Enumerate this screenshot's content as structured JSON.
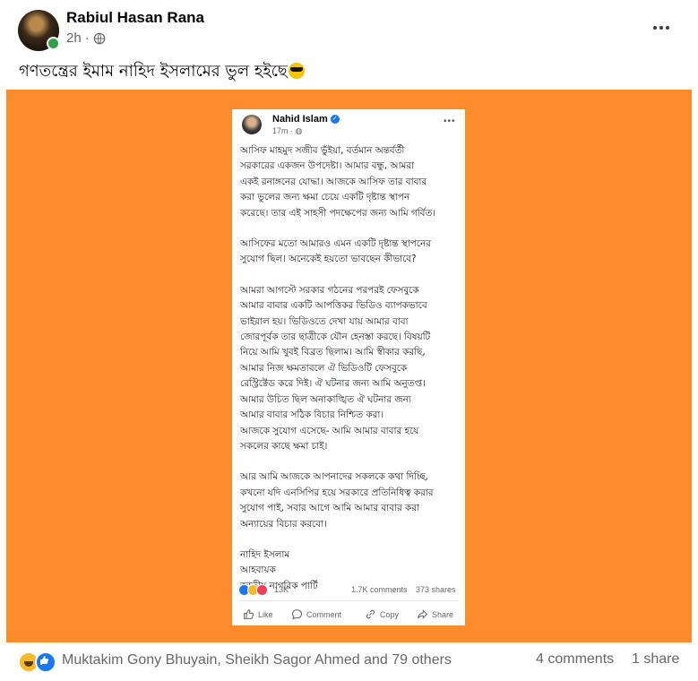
{
  "post": {
    "author": "Rabiul Hasan Rana",
    "time": "2h",
    "caption": "গণতন্ত্রের ইমাম নাহিদ ইসলামের ভুল হইছে",
    "caption_emoji": "sunglasses-emoji"
  },
  "embedded": {
    "author": "Nahid Islam",
    "time": "17m",
    "paragraphs": [
      "আসিফ মাহমুদ সজীব ভুঁইয়া, বর্তমান অন্তর্বর্তী\nসরকারের একজন উপদেষ্টা। আমার বন্ধু, আমরা\nএকই রনাঙ্গনের যোদ্ধা। আজকে আসিফ তার বাবার\nকরা ভুলের জন্য ক্ষমা চেয়ে একটি দৃষ্টান্ত স্থাপন\nকরেছে। তার এই সাহসী পদক্ষেপের জন্য আমি গর্বিত।",
      "আসিফের মতো আমারও এমন একটি দৃষ্টান্ত স্থাপনের\nসুযোগ ছিল। অনেকেই হয়তো ভাবছেন কীভাবে?",
      "আমরা আগস্টে সরকার গঠনের পরপরই ফেসবুকে\nআমার বাবার একটি আপত্তিকর ভিডিও ব্যাপকভাবে\nভাইরাল হয়। ভিডিওতে দেখা যায় আমার বাবা\nজোরপূর্বক তার ছাত্রীকে যৌন হেনস্তা করছে। বিষয়টি\nনিয়ে আমি খুবই বিব্রত ছিলাম। আমি স্বীকার করছি,\nআমার নিজ ক্ষমতাবলে ঐ ভিডিওটি ফেসবুকে\nরেস্ট্রিক্টেড করে দিই। ঐ ঘটনার জন্য আমি অনুতপ্ত।\nআমার উচিত ছিল অনাকাঙ্খিত ঐ ঘটনার জন্য\nআমার বাবার সঠিক বিচার নিশ্চিত করা।\nআজকে সুযোগ এসেছে- আমি আমার বাবার হয়ে\nসকলের কাছে ক্ষমা চাই।",
      "আর আমি আজকে আপনাদের সকলকে কথা দিচ্ছি,\nকখনো যদি এনসিপির হয়ে সরকারে প্রতিনিধিত্ব করার\nসুযোগ পাই, সবার আগে আমি আমার বাবার করা\nঅন্যায়ের বিচার করবো।",
      "নাহিদ ইসলাম\nআহবায়ক\nজাতীয় নাগরিক পার্টি"
    ],
    "reaction_count": "13K",
    "comments": "1.7K comments",
    "shares": "373 shares",
    "actions": {
      "like": "Like",
      "comment": "Comment",
      "copy": "Copy",
      "share": "Share"
    }
  },
  "footer": {
    "reactors": "Muktakim Gony Bhuyain, Sheikh Sagor Ahmed and 79 others",
    "comments": "4 comments",
    "shares": "1 share"
  },
  "colors": {
    "media_background": "#fe8c2c",
    "like_blue": "#1877f2",
    "meta_gray": "#65676b"
  }
}
